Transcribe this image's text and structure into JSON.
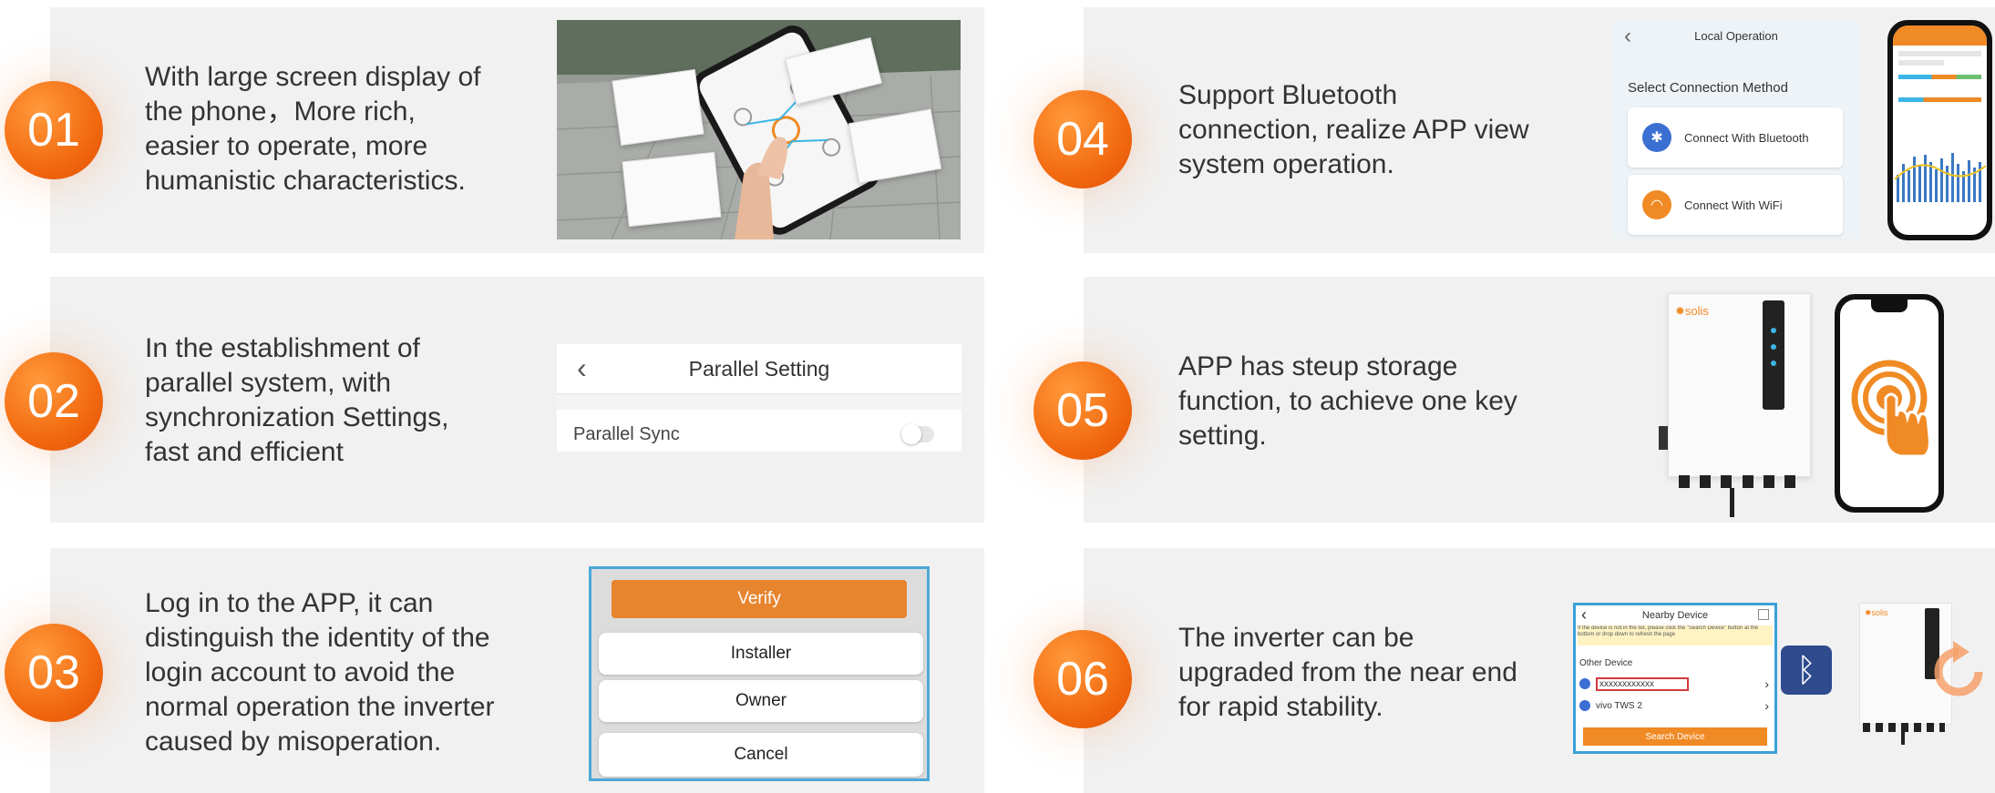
{
  "features": [
    {
      "number": "01",
      "text_lines": [
        "With large screen display of",
        "the phone，More rich,",
        "easier to operate, more",
        "humanistic characteristics."
      ]
    },
    {
      "number": "02",
      "text_lines": [
        "In the establishment of",
        "parallel system, with",
        "synchronization Settings,",
        "fast and efficient"
      ]
    },
    {
      "number": "03",
      "text_lines": [
        "Log in to the APP, it can",
        "distinguish the identity of the",
        "login account to avoid the",
        "normal operation the inverter",
        "caused by misoperation."
      ]
    },
    {
      "number": "04",
      "text_lines": [
        "Support Bluetooth",
        "connection, realize APP view",
        "system operation."
      ]
    },
    {
      "number": "05",
      "text_lines": [
        "APP has steup storage",
        "function, to achieve one key",
        "setting."
      ]
    },
    {
      "number": "06",
      "text_lines": [
        "The inverter can be",
        "upgraded from the near end",
        "for rapid stability."
      ]
    }
  ],
  "parallel_setting": {
    "title": "Parallel Setting",
    "row_label": "Parallel Sync"
  },
  "login_menu": {
    "verify": "Verify",
    "installer": "Installer",
    "owner": "Owner",
    "cancel": "Cancel"
  },
  "local_operation": {
    "title": "Local Operation",
    "prompt": "Select Connection Method",
    "bluetooth": "Connect With Bluetooth",
    "wifi": "Connect With WiFi"
  },
  "brand": {
    "logo_text": "solis"
  },
  "nearby_device": {
    "title": "Nearby Device",
    "notice": "If the device is not in the list, please click the \"Search Device\" button at the bottom or drop down to refresh the page",
    "section": "Other Device",
    "devices": [
      "xxxxxxxxxxxx",
      "vivo TWS 2"
    ],
    "search_button": "Search Device"
  },
  "colors": {
    "accent": "#f26a10",
    "card_bg": "#f1f1f1",
    "bluetooth": "#3b6fd1",
    "wifi": "#f08a24"
  }
}
